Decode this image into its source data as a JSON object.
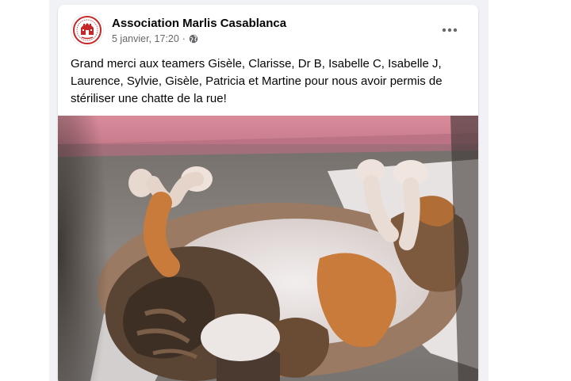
{
  "post": {
    "author": "Association Marlis Casablanca",
    "timestamp": "5 janvier, 17:20",
    "separator": "·",
    "audience_icon": "globe-icon",
    "more_icon": "more-options-icon",
    "text": "Grand merci aux teamers Gisèle, Clarisse, Dr B, Isabelle C, Isabelle J, Laurence, Sylvie, Gisèle, Patricia et Martine pour nous avoir permis de stériliser une chatte de la rue!"
  },
  "colors": {
    "background": "#f0f2f5",
    "card": "#ffffff",
    "name_text": "#050505",
    "secondary_text": "#65676b",
    "logo_red": "#c62828"
  }
}
